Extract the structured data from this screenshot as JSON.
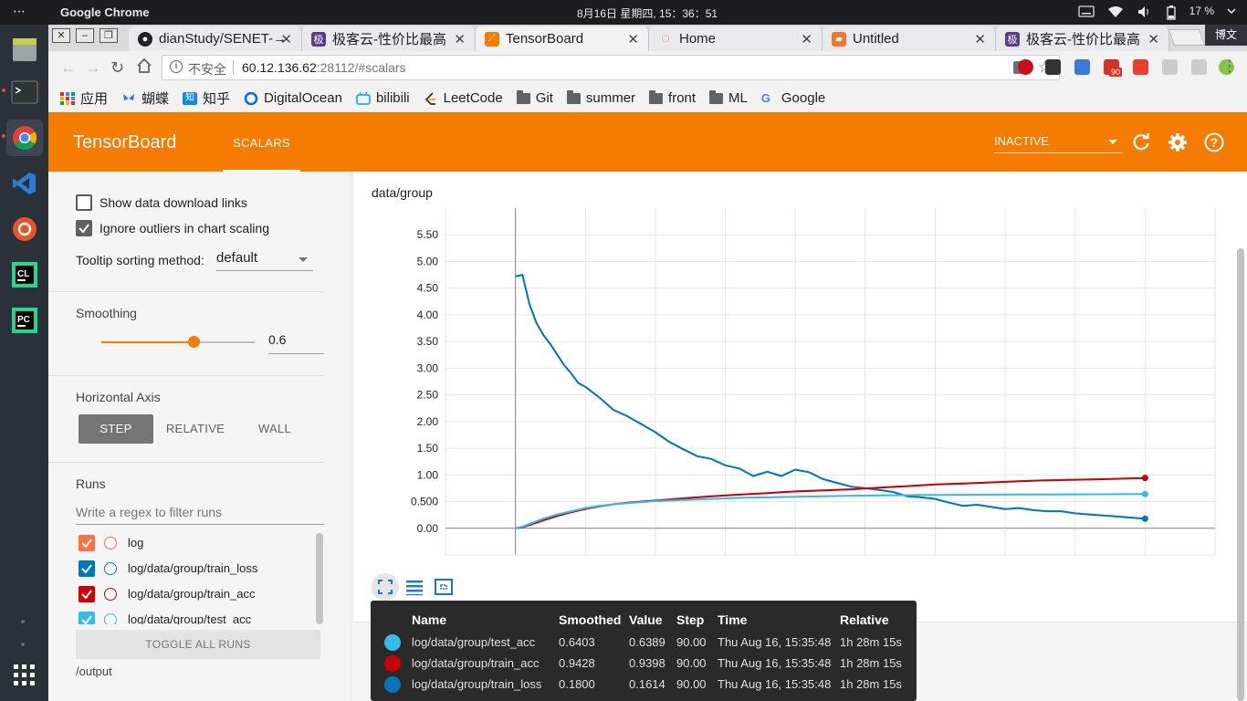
{
  "os": {
    "activities": "⋯",
    "app_name": "Google Chrome",
    "clock": "8月16日 星期四, 15：36：51",
    "battery": "17 %"
  },
  "browser": {
    "ime": "博文",
    "tabs": [
      {
        "title": "dianStudy/SENET-→",
        "icon": "github-icon"
      },
      {
        "title": "极客云-性价比最高",
        "icon": "jikeyun-icon"
      },
      {
        "title": "TensorBoard",
        "icon": "tensorboard-icon"
      },
      {
        "title": "Home",
        "icon": "jupyter-icon"
      },
      {
        "title": "Untitled",
        "icon": "notebook-icon"
      },
      {
        "title": "极客云-性价比最高",
        "icon": "jikeyun-icon"
      }
    ],
    "omnibox": {
      "security": "不安全",
      "host": "60.12.136.62",
      "rest": ":28112/#scalars"
    },
    "extension_badge": "90",
    "bookmarks": [
      {
        "label": "应用",
        "icon": "apps-icon"
      },
      {
        "label": "蝴蝶",
        "icon": "butterfly-icon"
      },
      {
        "label": "知乎",
        "icon": "zhihu-icon"
      },
      {
        "label": "DigitalOcean",
        "icon": "digitalocean-icon"
      },
      {
        "label": "bilibili",
        "icon": "bilibili-icon"
      },
      {
        "label": "LeetCode",
        "icon": "leetcode-icon"
      },
      {
        "label": "Git",
        "icon": "folder-icon"
      },
      {
        "label": "summer",
        "icon": "folder-icon"
      },
      {
        "label": "front",
        "icon": "folder-icon"
      },
      {
        "label": "ML",
        "icon": "folder-icon"
      },
      {
        "label": "Google",
        "icon": "google-icon"
      }
    ]
  },
  "tensorboard": {
    "title": "TensorBoard",
    "active_tab": "SCALARS",
    "status": "INACTIVE",
    "options": {
      "show_download_links": "Show data download links",
      "ignore_outliers": "Ignore outliers in chart scaling",
      "tooltip_sort_label": "Tooltip sorting method:",
      "tooltip_sort_value": "default"
    },
    "smoothing": {
      "title": "Smoothing",
      "value": "0.6",
      "level": 0.6
    },
    "horizontal_axis": {
      "title": "Horizontal Axis",
      "options": [
        "STEP",
        "RELATIVE",
        "WALL"
      ],
      "selected": "STEP"
    },
    "runs": {
      "title": "Runs",
      "filter_placeholder": "Write a regex to filter runs",
      "items": [
        {
          "label": "log",
          "color": "#ff7043"
        },
        {
          "label": "log/data/group/train_loss",
          "color": "#0077bb"
        },
        {
          "label": "log/data/group/train_acc",
          "color": "#cc0000"
        },
        {
          "label": "log/data/group/test_acc",
          "color": "#33bbee"
        }
      ],
      "toggle_all": "TOGGLE ALL RUNS",
      "logdir": "/output"
    },
    "chart": {
      "title": "data/group"
    },
    "tooltip": {
      "headers": [
        "Name",
        "Smoothed",
        "Value",
        "Step",
        "Time",
        "Relative"
      ],
      "rows": [
        {
          "name": "log/data/group/test_acc",
          "smoothed": "0.6403",
          "value": "0.6389",
          "step": "90.00",
          "time": "Thu Aug 16, 15:35:48",
          "relative": "1h 28m 15s",
          "color": "#33bbee"
        },
        {
          "name": "log/data/group/train_acc",
          "smoothed": "0.9428",
          "value": "0.9398",
          "step": "90.00",
          "time": "Thu Aug 16, 15:35:48",
          "relative": "1h 28m 15s",
          "color": "#cc0000"
        },
        {
          "name": "log/data/group/train_loss",
          "smoothed": "0.1800",
          "value": "0.1614",
          "step": "90.00",
          "time": "Thu Aug 16, 15:35:48",
          "relative": "1h 28m 15s",
          "color": "#0077bb"
        }
      ]
    }
  },
  "chart_data": {
    "type": "line",
    "title": "data/group",
    "xlabel": "",
    "ylabel": "",
    "xlim": [
      -10,
      100
    ],
    "ylim": [
      -0.5,
      6.0
    ],
    "yticks": [
      "0.00",
      "0.500",
      "1.00",
      "1.50",
      "2.00",
      "2.50",
      "3.00",
      "3.50",
      "4.00",
      "4.50",
      "5.00",
      "5.50"
    ],
    "grid": true,
    "series": [
      {
        "name": "log/data/group/train_loss",
        "color": "#0077bb",
        "x": [
          0,
          1,
          2,
          3,
          4,
          5,
          6,
          7,
          8,
          9,
          10,
          12,
          14,
          16,
          18,
          20,
          22,
          24,
          26,
          28,
          30,
          32,
          34,
          36,
          38,
          40,
          42,
          44,
          46,
          48,
          50,
          52,
          54,
          56,
          58,
          60,
          62,
          64,
          66,
          68,
          70,
          72,
          74,
          76,
          78,
          80,
          82,
          84,
          86,
          88,
          90
        ],
        "y": [
          4.72,
          4.75,
          4.2,
          3.85,
          3.62,
          3.45,
          3.25,
          3.05,
          2.9,
          2.72,
          2.65,
          2.45,
          2.22,
          2.1,
          1.95,
          1.8,
          1.62,
          1.48,
          1.35,
          1.3,
          1.18,
          1.12,
          0.98,
          1.06,
          0.98,
          1.1,
          1.05,
          0.92,
          0.85,
          0.78,
          0.75,
          0.72,
          0.68,
          0.6,
          0.58,
          0.55,
          0.48,
          0.42,
          0.44,
          0.4,
          0.36,
          0.38,
          0.34,
          0.32,
          0.32,
          0.28,
          0.26,
          0.24,
          0.22,
          0.2,
          0.18
        ]
      },
      {
        "name": "log/data/group/train_acc",
        "color": "#cc0000",
        "x": [
          0,
          1,
          2,
          4,
          6,
          8,
          10,
          12,
          14,
          16,
          18,
          20,
          24,
          28,
          32,
          36,
          40,
          44,
          48,
          52,
          56,
          60,
          64,
          68,
          72,
          76,
          80,
          84,
          88,
          90
        ],
        "y": [
          0.0,
          0.02,
          0.06,
          0.15,
          0.23,
          0.3,
          0.36,
          0.41,
          0.45,
          0.48,
          0.5,
          0.52,
          0.56,
          0.6,
          0.63,
          0.66,
          0.69,
          0.71,
          0.73,
          0.76,
          0.79,
          0.82,
          0.84,
          0.86,
          0.88,
          0.9,
          0.91,
          0.92,
          0.935,
          0.9428
        ]
      },
      {
        "name": "log/data/group/test_acc",
        "color": "#33bbee",
        "x": [
          0,
          1,
          2,
          4,
          6,
          8,
          10,
          12,
          14,
          16,
          18,
          20,
          24,
          28,
          32,
          36,
          40,
          44,
          48,
          52,
          56,
          60,
          64,
          68,
          72,
          76,
          80,
          84,
          88,
          90
        ],
        "y": [
          0.0,
          0.03,
          0.08,
          0.18,
          0.26,
          0.32,
          0.38,
          0.42,
          0.45,
          0.47,
          0.49,
          0.51,
          0.53,
          0.55,
          0.57,
          0.58,
          0.59,
          0.6,
          0.61,
          0.615,
          0.62,
          0.625,
          0.627,
          0.63,
          0.632,
          0.634,
          0.636,
          0.638,
          0.639,
          0.6403
        ]
      }
    ]
  }
}
